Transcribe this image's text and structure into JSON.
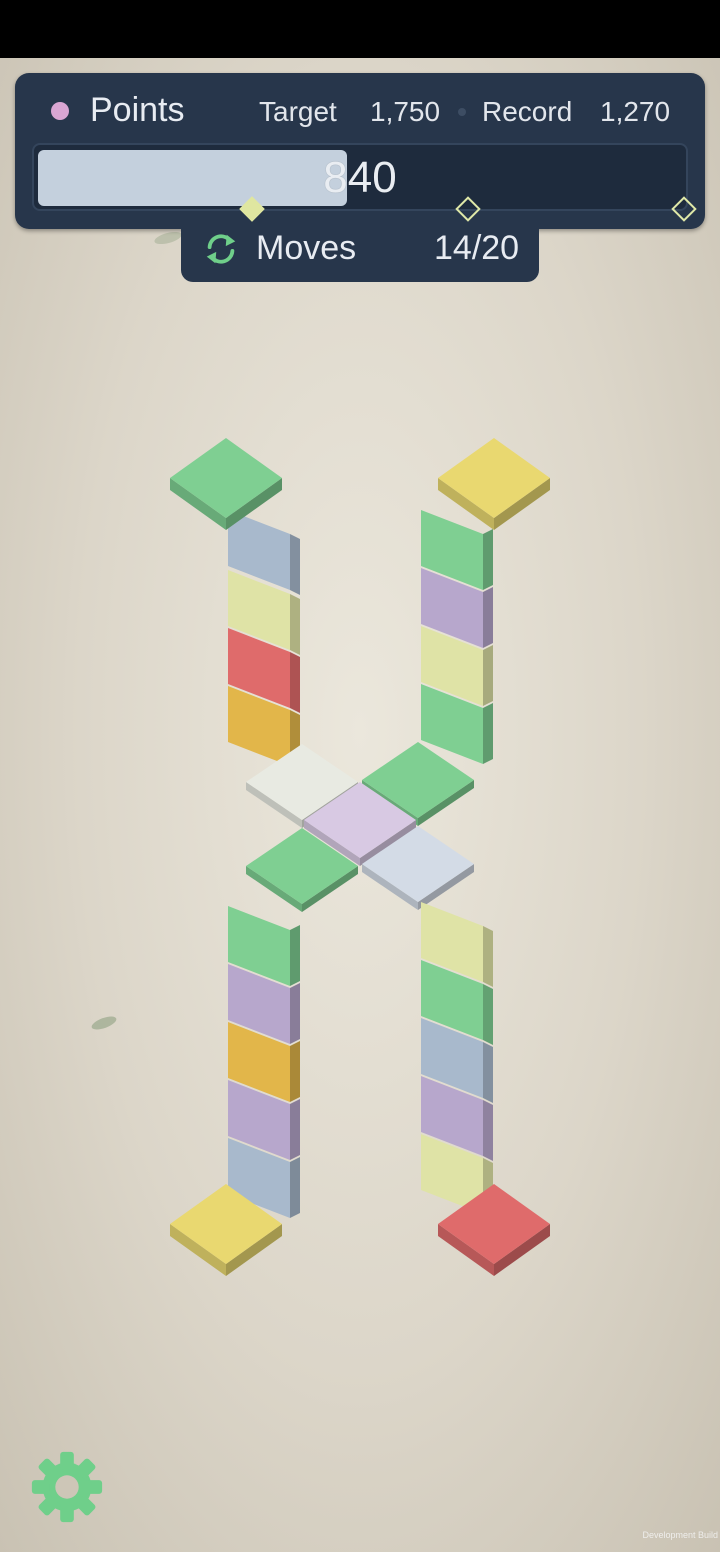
{
  "hud": {
    "points_label": "Points",
    "target_label": "Target",
    "target_value": "1,750",
    "record_label": "Record",
    "record_value": "1,270",
    "score_value": "840",
    "progress_fraction": 0.48,
    "milestones": [
      {
        "state": "reached"
      },
      {
        "state": "pending"
      },
      {
        "state": "pending"
      }
    ]
  },
  "moves": {
    "label": "Moves",
    "value": "14/20",
    "icon": "refresh-icon"
  },
  "settings": {
    "icon": "gear-icon"
  },
  "build_tag": "Development Build",
  "colors": {
    "hud_bg": "#27364b",
    "points_dot": "#d9a6d3",
    "accent_green": "#6fcf8a",
    "green": "#7fcf92",
    "blue": "#a8b9cc",
    "yellow": "#e9d870",
    "red": "#df6b6b",
    "orange": "#e2b64a",
    "purple": "#b7a7cc",
    "lime": "#dfe3a6",
    "white": "#e8eae2",
    "lavender": "#d8c9e3",
    "pale_blue": "#d3dbe6"
  },
  "board": {
    "top_caps": [
      {
        "color": "green"
      },
      {
        "color": "yellow"
      }
    ],
    "upper_left_column": [
      "blue",
      "lime",
      "red",
      "orange"
    ],
    "upper_right_column": [
      "green",
      "purple",
      "lime",
      "green"
    ],
    "crossing": [
      "white",
      "green",
      "lavender",
      "green",
      "pale_blue"
    ],
    "lower_left_column": [
      "green",
      "purple",
      "orange",
      "purple",
      "blue"
    ],
    "lower_right_column": [
      "lime",
      "green",
      "blue",
      "purple",
      "lime"
    ],
    "bottom_caps": [
      {
        "color": "yellow"
      },
      {
        "color": "red"
      }
    ]
  }
}
